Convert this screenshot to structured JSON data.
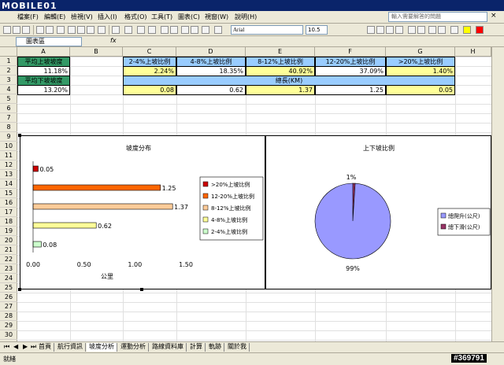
{
  "logo": "MOBILE01",
  "menu": [
    "檔案(F)",
    "編輯(E)",
    "檢視(V)",
    "插入(I)",
    "格式(O)",
    "工具(T)",
    "圖表(C)",
    "視窗(W)",
    "說明(H)"
  ],
  "help_placeholder": "輸入需要解答的問題",
  "font": "Arial",
  "font_size": "10.5",
  "name_box": "圖表區",
  "fx": "fx",
  "columns": [
    "A",
    "B",
    "C",
    "D",
    "E",
    "F",
    "G",
    "H"
  ],
  "rows": [
    "1",
    "2",
    "3",
    "4",
    "5",
    "6",
    "7",
    "8",
    "9",
    "10",
    "11",
    "12",
    "13",
    "14",
    "15",
    "16",
    "17",
    "18",
    "19",
    "20",
    "21",
    "22",
    "23",
    "24",
    "25",
    "26",
    "27",
    "28",
    "29",
    "30"
  ],
  "cells": {
    "a1": "平均上坡坡度",
    "a2": "11.18%",
    "a3": "平均下坡坡度",
    "a4": "13.20%",
    "c1": "2-4%上坡比例",
    "d1": "4-8%上坡比例",
    "e1": "8-12%上坡比例",
    "f1": "12-20%上坡比例",
    "g1": "&gt;20%上坡比例",
    "c2": "2.24%",
    "d2": "18.35%",
    "e2": "40.92%",
    "f2": "37.09%",
    "g2": "1.40%",
    "c3": "總長(KM)",
    "c4": "0.08",
    "d4": "0.62",
    "e4": "1.37",
    "f4": "1.25",
    "g4": "0.05"
  },
  "bar_chart": {
    "title": "坡度分布",
    "xlabel": "公里",
    "ticks": [
      "0.00",
      "0.50",
      "1.00",
      "1.50"
    ],
    "legend": [
      ">20%上坡比例",
      "12-20%上坡比例",
      "8-12%上坡比例",
      "4-8%上坡比例",
      "2-4%上坡比例"
    ]
  },
  "pie_chart": {
    "title": "上下坡比例",
    "label_small": "1%",
    "label_big": "99%",
    "legend": [
      "總爬升(公尺)",
      "總下滑(公尺)"
    ]
  },
  "chart_data": [
    {
      "type": "bar",
      "title": "坡度分布",
      "xlabel": "公里",
      "xlim": [
        0,
        1.5
      ],
      "categories": [
        ">20%上坡比例",
        "12-20%上坡比例",
        "8-12%上坡比例",
        "4-8%上坡比例",
        "2-4%上坡比例"
      ],
      "values": [
        0.05,
        1.25,
        1.37,
        0.62,
        0.08
      ],
      "colors": [
        "#cc0000",
        "#ff6600",
        "#ffcc99",
        "#ffff99",
        "#ccffcc"
      ],
      "legend": "right"
    },
    {
      "type": "pie",
      "title": "上下坡比例",
      "categories": [
        "總爬升(公尺)",
        "總下滑(公尺)"
      ],
      "values": [
        99,
        1
      ],
      "colors": [
        "#9999ff",
        "#993366"
      ],
      "legend": "right"
    }
  ],
  "tabs": [
    "首頁",
    "航行資訊",
    "坡度分析",
    "運動分析",
    "路線資料庫",
    "計算",
    "軌跡",
    "關於我"
  ],
  "status": "就緒",
  "watermark": "#369791",
  "colors": {
    "header_blue": "#99ccff",
    "value_yellow": "#ffff99",
    "green": "#339966",
    "title": "#0a246a"
  }
}
